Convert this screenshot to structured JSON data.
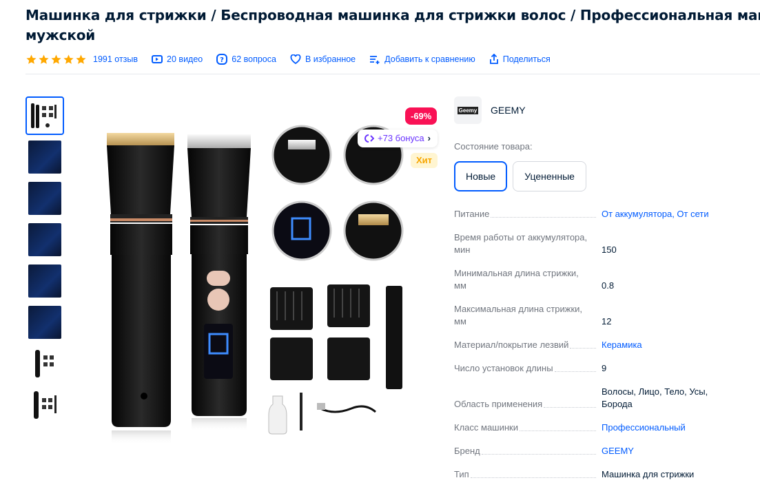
{
  "title": {
    "line1": "Машинка для стрижки / Беспроводная машинка для стрижки волос / Профессиональная машинка",
    "line2": "мужской"
  },
  "meta": {
    "rating_stars": 5,
    "reviews": "1991 отзыв",
    "videos": "20 видео",
    "questions": "62 вопроса",
    "favorite": "В избранное",
    "compare": "Добавить к сравнению",
    "share": "Поделиться"
  },
  "badges": {
    "discount": "-69%",
    "bonus": "+73 бонуса",
    "hit": "Хит"
  },
  "brand": {
    "logo_text": "Geemy",
    "name": "GEEMY"
  },
  "condition": {
    "label": "Состояние товара:",
    "options": [
      "Новые",
      "Уцененные"
    ],
    "selected": "Новые"
  },
  "specs": [
    {
      "key": "Питание",
      "value": "От аккумулятора, От сети"
    },
    {
      "key": "Время работы от аккумулятора, мин",
      "value": "150"
    },
    {
      "key": "Минимальная длина стрижки, мм",
      "value": "0.8"
    },
    {
      "key": "Максимальная длина стрижки, мм",
      "value": "12"
    },
    {
      "key": "Материал/покрытие лезвий",
      "value": "Керамика"
    },
    {
      "key": "Число установок длины",
      "value": "9"
    },
    {
      "key": "Область применения",
      "value": "Волосы, Лицо, Тело, Усы, Борода"
    },
    {
      "key": "Класс машинки",
      "value": "Профессиональный"
    },
    {
      "key": "Бренд",
      "value": "GEEMY"
    },
    {
      "key": "Тип",
      "value": "Машинка для стрижки"
    }
  ],
  "thumbnails_count": 8,
  "colors": {
    "accent": "#005bff",
    "discount": "#f91155",
    "bonus": "#6a34ff",
    "hit": "#f7a600",
    "star": "#ffa800"
  }
}
